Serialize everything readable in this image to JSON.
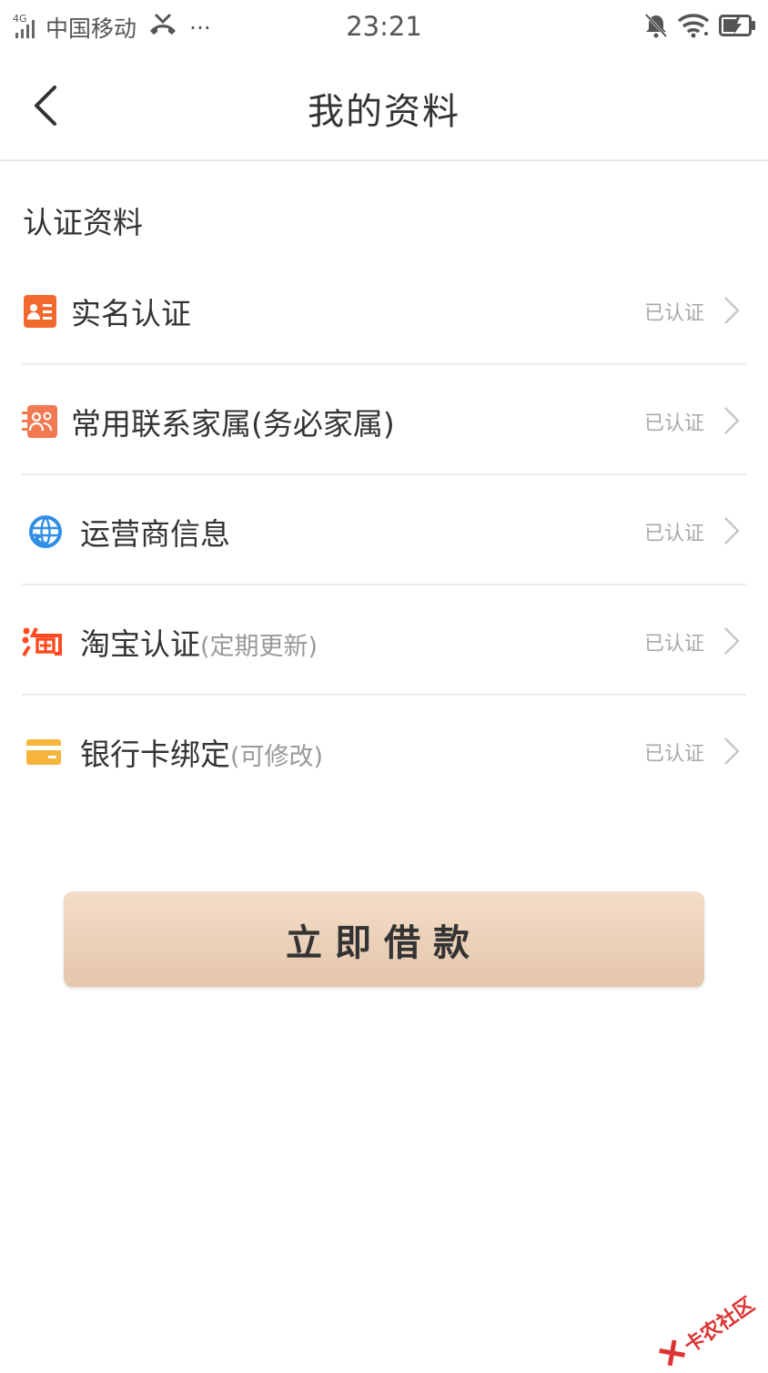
{
  "status_bar": {
    "network": "4G",
    "carrier": "中国移动",
    "more": "···",
    "time": "23:21",
    "icons": [
      "signal-icon",
      "missed-call-icon",
      "mute-bell-icon",
      "wifi-icon",
      "battery-charging-icon"
    ]
  },
  "nav": {
    "back_icon": "chevron-left-icon",
    "title": "我的资料"
  },
  "section": {
    "title": "认证资料"
  },
  "items": [
    {
      "icon": "id-card-icon",
      "label": "实名认证",
      "sub": "",
      "status": "已认证",
      "color": "#ef6a2c"
    },
    {
      "icon": "contacts-icon",
      "label": "常用联系家属(务必家属)",
      "sub": "",
      "status": "已认证",
      "color": "#f17a52"
    },
    {
      "icon": "globe-refresh-icon",
      "label": "运营商信息",
      "sub": "",
      "status": "已认证",
      "color": "#2f8ee6"
    },
    {
      "icon": "taobao-icon",
      "label": "淘宝认证",
      "sub": "(定期更新)",
      "status": "已认证",
      "color": "#ff4b1f"
    },
    {
      "icon": "bank-card-icon",
      "label": "银行卡绑定",
      "sub": "(可修改)",
      "status": "已认证",
      "color": "#f6b53c"
    }
  ],
  "cta": {
    "label": "立即借款"
  },
  "watermark": {
    "text": "卡农社区",
    "icon": "kanong-logo-icon"
  }
}
